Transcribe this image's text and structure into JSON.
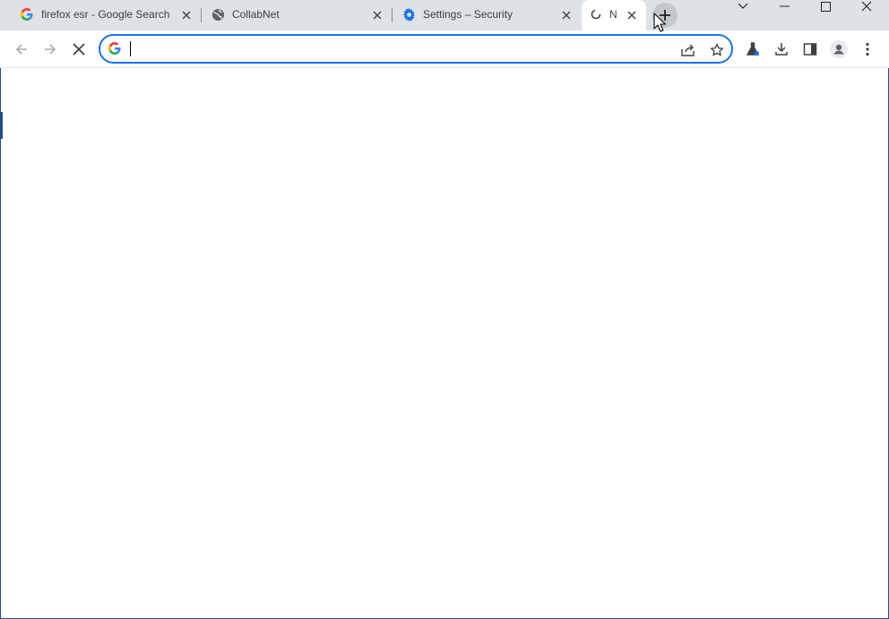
{
  "tabs": [
    {
      "title": "firefox esr - Google Search",
      "favicon": "google-g-icon",
      "active": false
    },
    {
      "title": "CollabNet",
      "favicon": "globe-icon",
      "active": false
    },
    {
      "title": "Settings – Security",
      "favicon": "gear-icon",
      "active": false
    },
    {
      "title": "N",
      "favicon": "loading-spinner-icon",
      "active": true
    }
  ],
  "omnibox": {
    "value": "",
    "placeholder": ""
  },
  "colors": {
    "accent": "#1a73e8",
    "tabstrip": "#dee1e6",
    "window_border": "#1f4e8c"
  }
}
